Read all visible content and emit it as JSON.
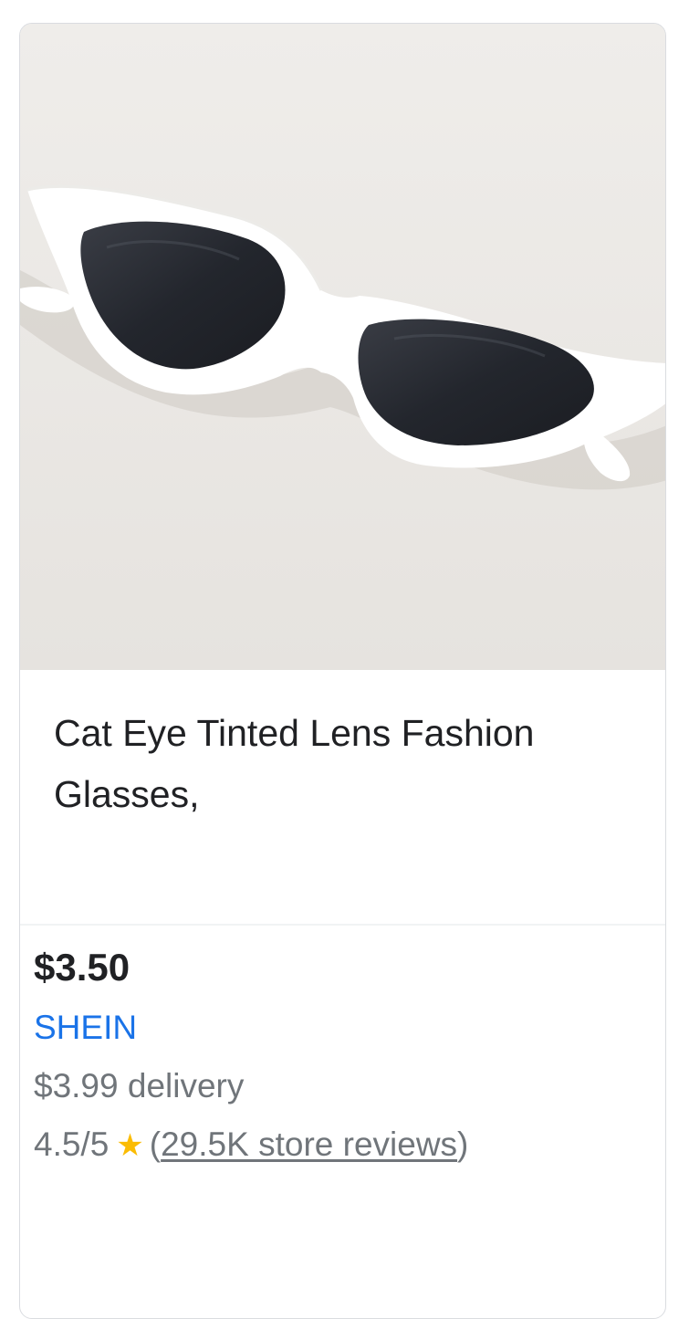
{
  "product": {
    "image_alt": "Cat Eye Tinted Lens Fashion Glasses",
    "title": "Cat Eye Tinted Lens Fashion Glasses,",
    "price": "$3.50",
    "store": "SHEIN",
    "delivery": "$3.99 delivery",
    "rating": "4.5/5",
    "star_icon": "star-icon",
    "reviews_open": "(",
    "reviews_link": "29.5K store reviews",
    "reviews_close": ")",
    "colors": {
      "price": "#202124",
      "store": "#1a73e8",
      "secondary": "#70757a",
      "star": "#fbbc04"
    }
  }
}
